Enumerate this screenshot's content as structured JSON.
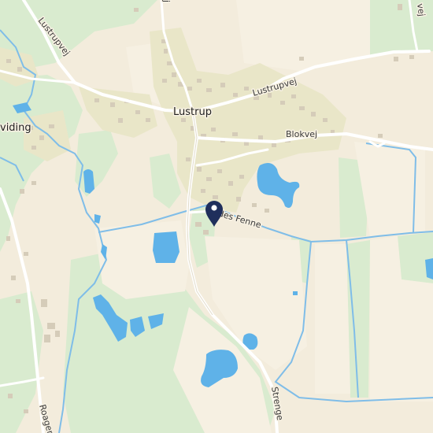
{
  "map": {
    "labels": {
      "town": "Lustrup",
      "village_left": "viding",
      "road_lustrup_nw": "Lustrupvej",
      "road_lustrup_ne": "Lustrupvej",
      "road_blokvej": "Blokvej",
      "road_fenne": "Hedes Fenne",
      "road_strenge": "Strenge",
      "road_roager": "Roager",
      "road_top_right": "vej",
      "road_top_mid": "j"
    },
    "pin": {
      "color": "#1f2f5c",
      "icon": "map-pin-icon"
    },
    "colors": {
      "land": "#f3ecdc",
      "green": "#d8ead0",
      "built": "#e8e6cc",
      "water": "#5fb2e8",
      "stream": "#7fbde8",
      "road": "#ffffff",
      "building": "#d9d1bf"
    }
  }
}
